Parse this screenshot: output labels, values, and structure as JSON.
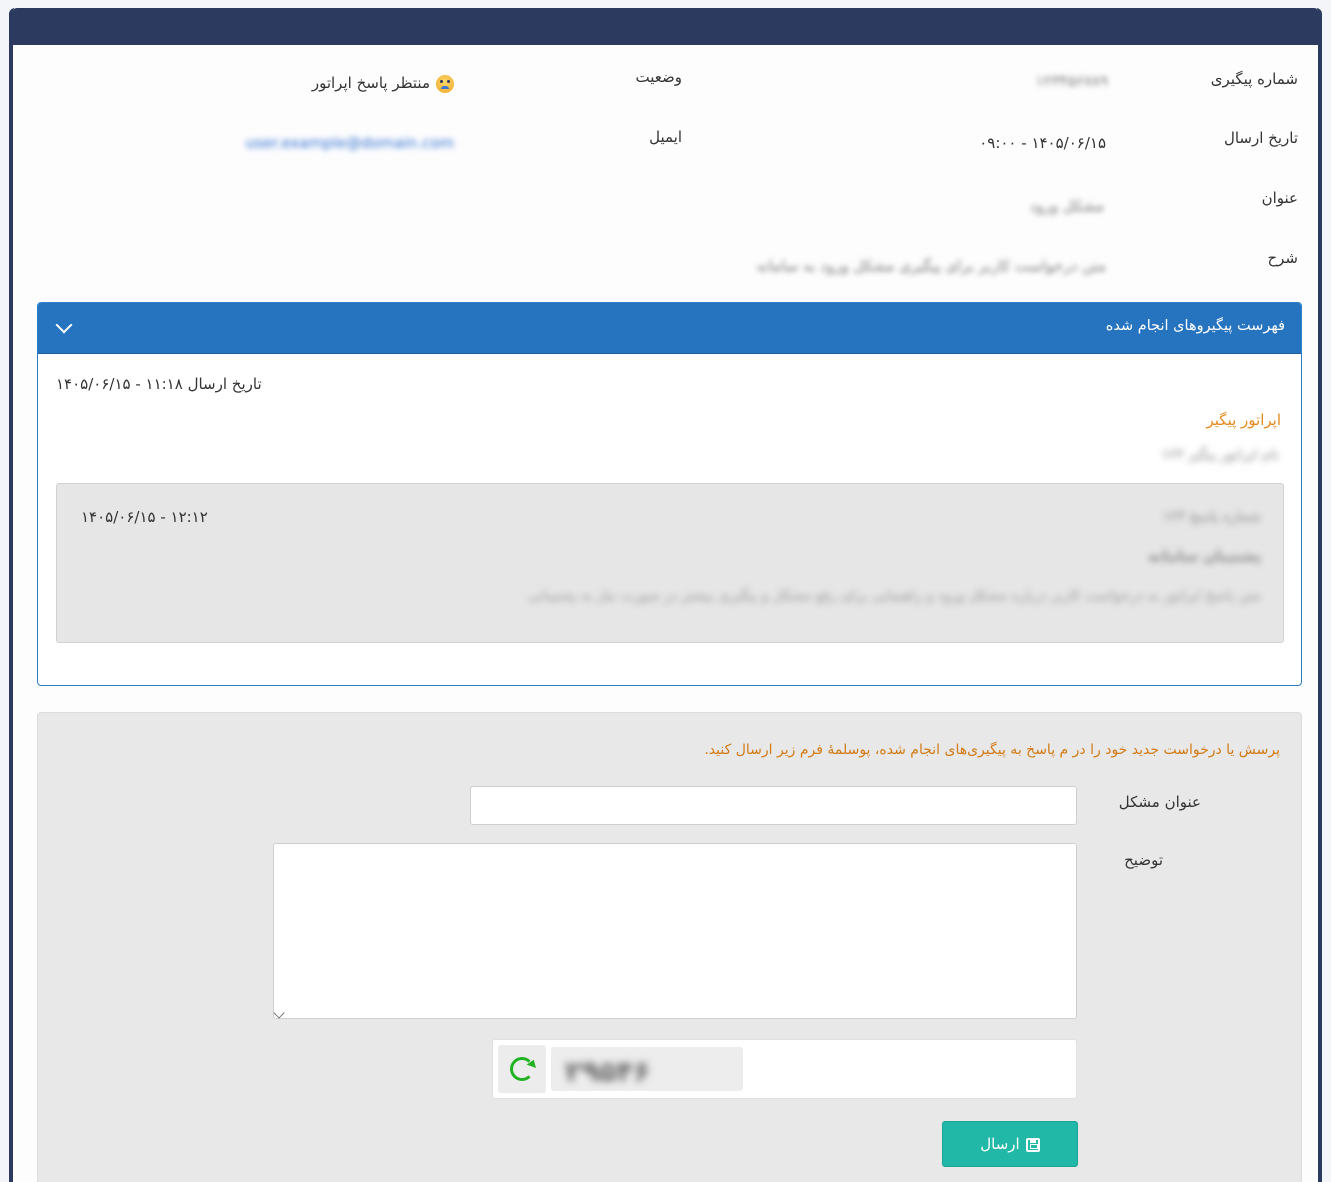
{
  "ticket": {
    "tracking_label": "شماره پیگیری",
    "tracking_value": "۱۲۳۴۵۶۷۸۹",
    "status_label": "وضعیت",
    "status_value": "منتظر پاسخ اپراتور",
    "sent_date_label": "تاریخ ارسال",
    "sent_date_value": "۱۴۰۵/۰۶/۱۵ - ۰۹:۰۰",
    "email_label": "ایمیل",
    "email_value": "user.example@domain.com",
    "subject_label": "عنوان",
    "subject_value": "مشکل ورود",
    "description_label": "شرح",
    "description_value": "متن درخواست کاربر برای پیگیری مشکل ورود به سامانه"
  },
  "followups": {
    "title": "فهرست پیگیروهای انجام شده",
    "item_date": "تاریخ ارسال ۱۱:۱۸ - ۱۴۰۵/۰۶/۱۵",
    "operator_label": "اپراتور پیگیر",
    "operator_name": "نام اپراتور پیگیر ۱۲۳",
    "reply_date": "۱۲:۱۲ - ۱۴۰۵/۰۶/۱۵",
    "reply_code": "شماره پاسخ ۱۲۳",
    "reply_author": "پشتیبان سامانه",
    "reply_text": "متن پاسخ اپراتور به درخواست کاربر درباره مشکل ورود و راهنمایی برای رفع مشکل و پیگیری بیشتر در صورت نیاز به پشتیبانی"
  },
  "form": {
    "hint": "پرسش یا درخواست جدید خود را در م پاسخ به پیگیری‌های انجام شده، پوسلمهٔ فرم زیر ارسال کنید.",
    "title_label": "عنوان مشکل",
    "title_value": "",
    "description_label": "توضیح",
    "description_value": "",
    "captcha_code": "۲۹۵۴۶",
    "submit_label": "ارسال"
  },
  "colors": {
    "topbar": "#2b3a5e",
    "panel_header": "#2673c0",
    "operator": "#e58a1e",
    "hint": "#d37a14",
    "submit": "#21b8a8",
    "refresh": "#22b322"
  }
}
